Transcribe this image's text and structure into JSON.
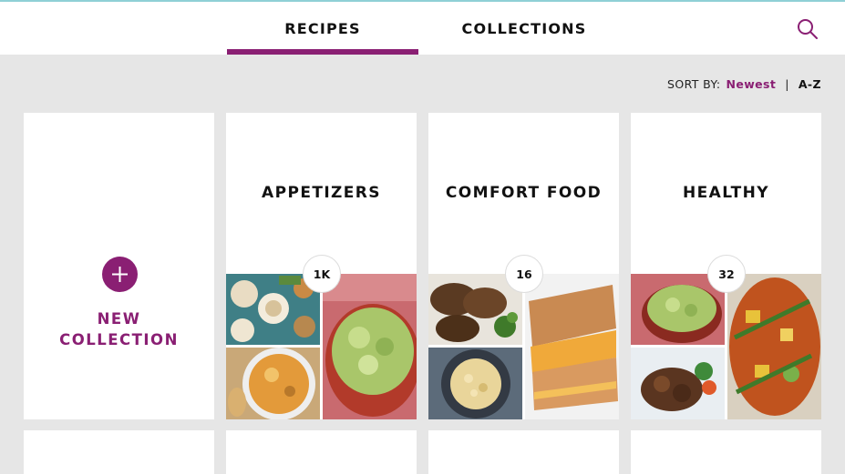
{
  "tabs": {
    "recipes": "RECIPES",
    "collections": "COLLECTIONS",
    "active": "RECIPES"
  },
  "header": {
    "search_icon": "search-icon"
  },
  "sort": {
    "label": "SORT BY:",
    "newest": "Newest",
    "separator": "|",
    "az": "A-Z",
    "selected": "Newest"
  },
  "new_collection": {
    "line1": "NEW",
    "line2": "COLLECTION",
    "icon": "plus-icon"
  },
  "collections": [
    {
      "title": "APPETIZERS",
      "count": "1K"
    },
    {
      "title": "COMFORT FOOD",
      "count": "16"
    },
    {
      "title": "HEALTHY",
      "count": "32"
    }
  ],
  "colors": {
    "accent": "#8a1f73",
    "background": "#e6e6e6",
    "card": "#ffffff",
    "top_line": "#8fd0d6"
  }
}
